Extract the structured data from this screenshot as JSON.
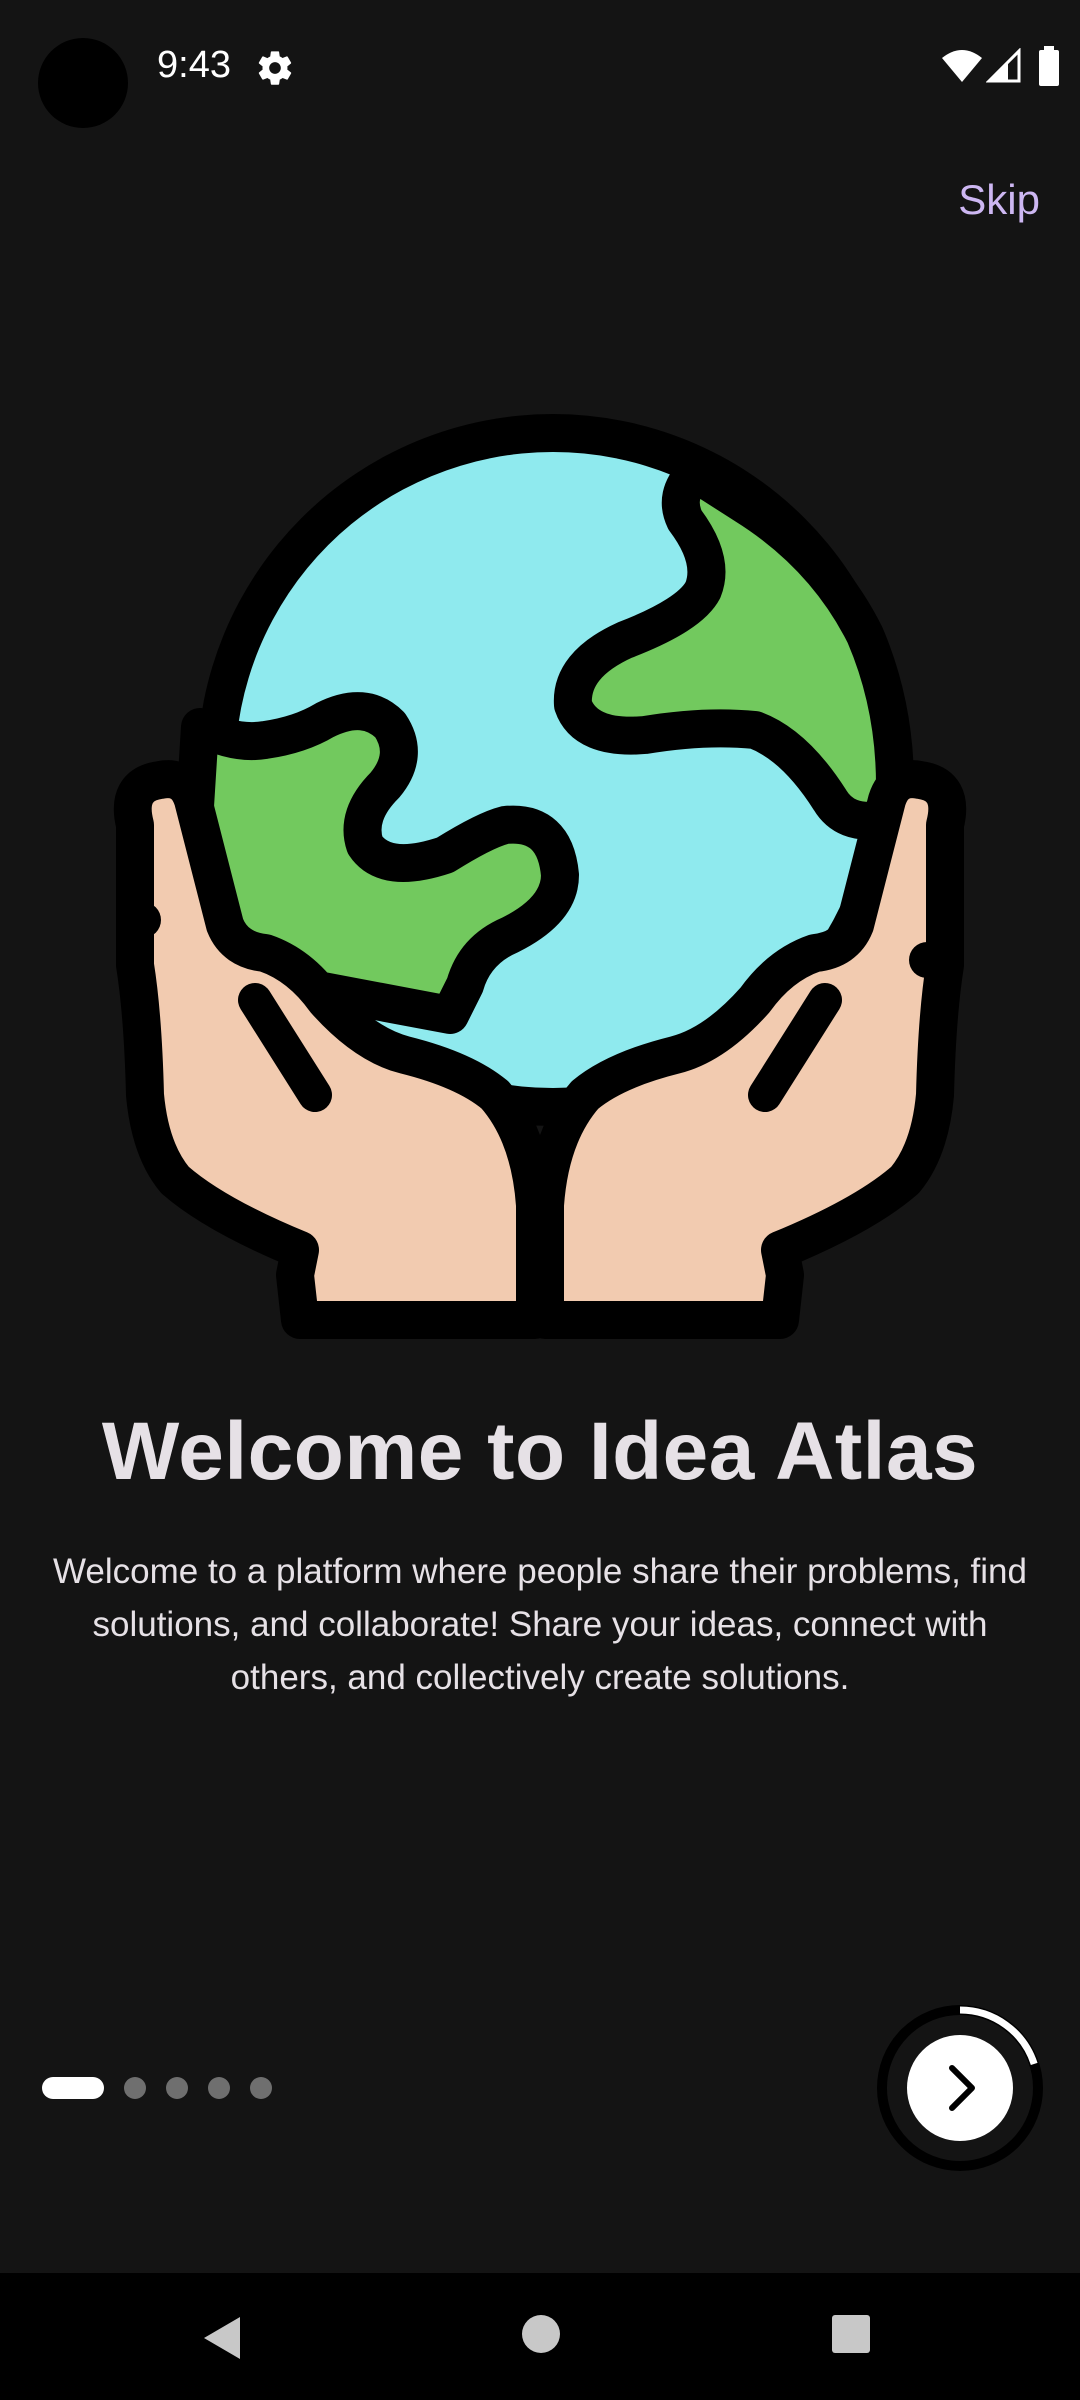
{
  "status_bar": {
    "time": "9:43",
    "icons": [
      "camera-cutout",
      "settings-icon",
      "wifi-icon",
      "signal-icon",
      "battery-icon"
    ]
  },
  "onboarding": {
    "skip_label": "Skip",
    "illustration": "hands-holding-globe",
    "title": "Welcome to Idea Atlas",
    "description": "Welcome to a platform where people share their problems, find solutions, and collaborate! Share your ideas, connect with others, and collectively create solutions.",
    "page_indicator": {
      "total": 5,
      "current": 1
    },
    "next_button": {
      "icon": "chevron-right-icon",
      "progress": 0.2
    }
  },
  "colors": {
    "background": "#141414",
    "accent": "#cdb7f2",
    "ocean": "#8feaee",
    "land": "#72c95e",
    "skin": "#f2cbb0"
  },
  "nav_bar": {
    "icons": [
      "back-icon",
      "home-icon",
      "recents-icon"
    ]
  }
}
